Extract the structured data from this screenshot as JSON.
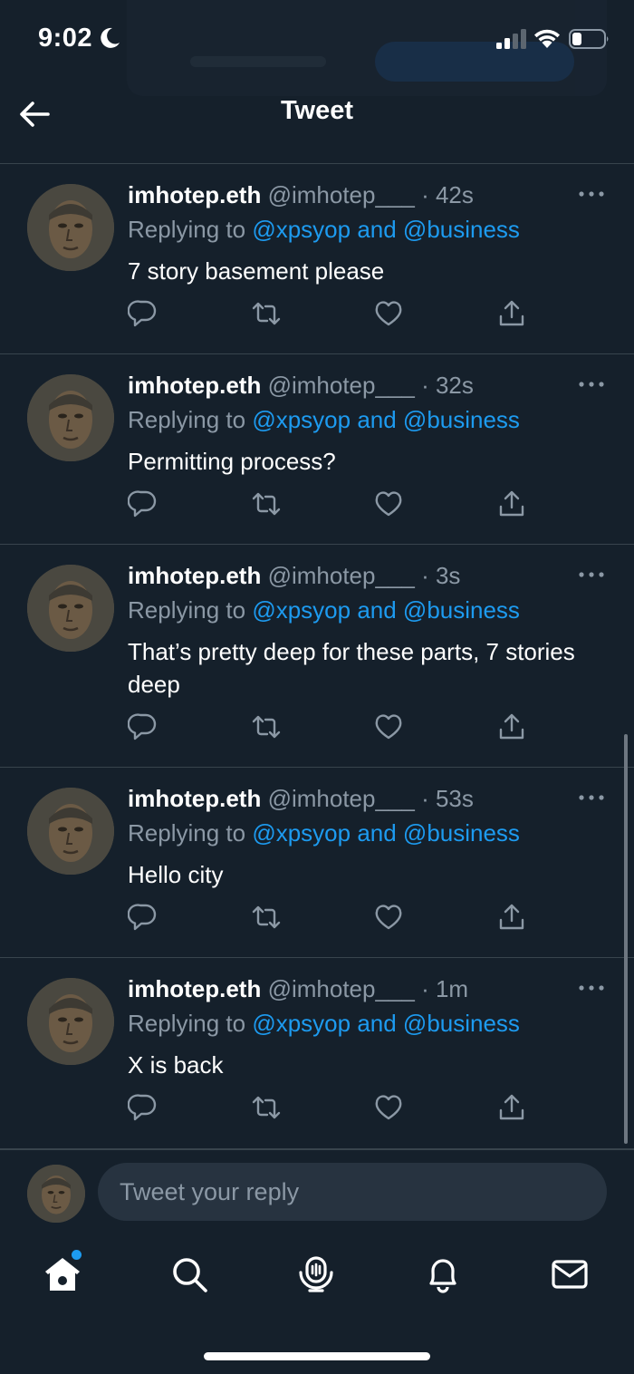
{
  "status_bar": {
    "time": "9:02",
    "icons": [
      "moon-icon",
      "cellular-signal-icon",
      "wifi-icon",
      "battery-icon"
    ]
  },
  "header": {
    "title": "Tweet",
    "back_icon": "arrow-left-icon"
  },
  "tweets": [
    {
      "name": "imhotep.eth",
      "handle": "@imhotep___",
      "time": "· 42s",
      "replying_prefix": "Replying to ",
      "mention1": "@xpsyop",
      "mention_and": " and ",
      "mention2": "@business",
      "text": "7 story basement please"
    },
    {
      "name": "imhotep.eth",
      "handle": "@imhotep___",
      "time": "· 32s",
      "replying_prefix": "Replying to ",
      "mention1": "@xpsyop",
      "mention_and": " and ",
      "mention2": "@business",
      "text": "Permitting process?"
    },
    {
      "name": "imhotep.eth",
      "handle": "@imhotep___",
      "time": "· 3s",
      "replying_prefix": "Replying to ",
      "mention1": "@xpsyop",
      "mention_and": " and ",
      "mention2": "@business",
      "text": "That’s pretty deep for these parts, 7 stories deep"
    },
    {
      "name": "imhotep.eth",
      "handle": "@imhotep___",
      "time": "· 53s",
      "replying_prefix": "Replying to ",
      "mention1": "@xpsyop",
      "mention_and": " and ",
      "mention2": "@business",
      "text": "Hello city"
    },
    {
      "name": "imhotep.eth",
      "handle": "@imhotep___",
      "time": "· 1m",
      "replying_prefix": "Replying to ",
      "mention1": "@xpsyop",
      "mention_and": " and ",
      "mention2": "@business",
      "text": "X is back"
    }
  ],
  "tweet_action_icons": [
    "reply-icon",
    "retweet-icon",
    "like-icon",
    "share-icon"
  ],
  "reply_bar": {
    "placeholder": "Tweet your reply"
  },
  "tabbar": {
    "items": [
      "home-icon",
      "search-icon",
      "spaces-icon",
      "notifications-icon",
      "messages-icon"
    ],
    "home_has_notification_dot": true
  },
  "colors": {
    "background": "#15202b",
    "accent": "#1d9bf0",
    "secondary_text": "#8b98a5",
    "divider": "#38444d"
  }
}
